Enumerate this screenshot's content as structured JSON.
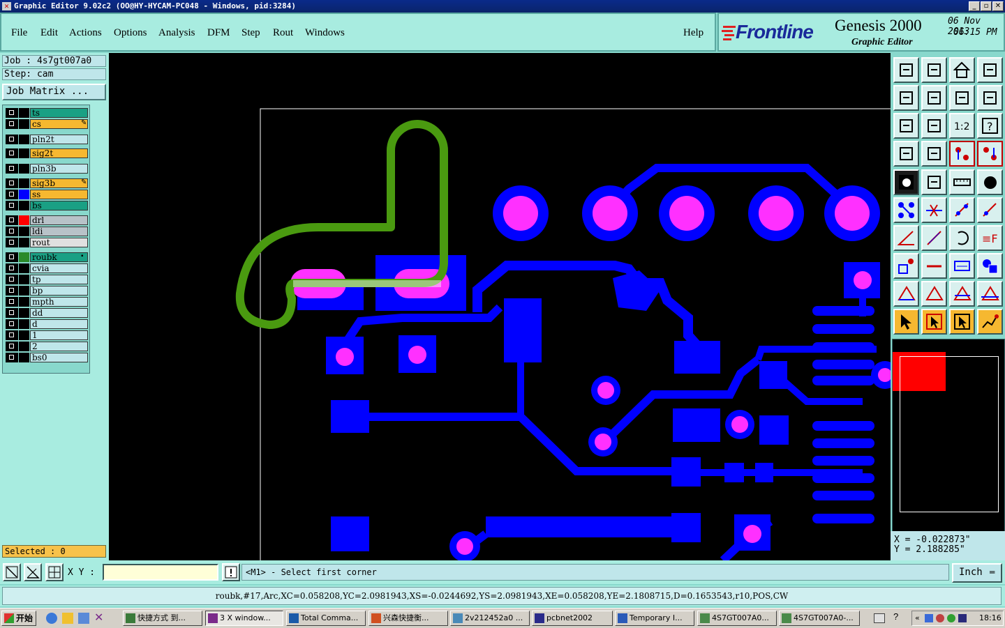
{
  "window": {
    "title": "Graphic Editor 9.02c2 (OO@HY-HYCAM-PC048 - Windows, pid:3284)"
  },
  "menu": [
    "File",
    "Edit",
    "Actions",
    "Options",
    "Analysis",
    "DFM",
    "Step",
    "Rout",
    "Windows"
  ],
  "help_label": "Help",
  "brand": {
    "logo": "Frontline",
    "product": "Genesis 2000",
    "subtitle": "Graphic Editor",
    "date": "06 Nov 2013",
    "time": "06:15 PM"
  },
  "job": {
    "job_line": "Job : 4s7gt007a0",
    "step_line": "Step: cam",
    "matrix_button": "Job Matrix ..."
  },
  "layers": [
    {
      "name": "ts",
      "color": "#1aa084",
      "swatch": "#000000",
      "mark": ""
    },
    {
      "name": "cs",
      "color": "#f6b830",
      "swatch": "#000000",
      "mark": "✎"
    },
    {
      "name": "pln2t",
      "color": "#bfe6ea",
      "swatch": "#000000",
      "mark": ""
    },
    {
      "name": "sig2t",
      "color": "#f6b830",
      "swatch": "#000000",
      "mark": ""
    },
    {
      "name": "pln3b",
      "color": "#bfe6ea",
      "swatch": "#000000",
      "mark": ""
    },
    {
      "name": "sig3b",
      "color": "#f6b830",
      "swatch": "#000000",
      "mark": "✎"
    },
    {
      "name": "ss",
      "color": "#f6b830",
      "swatch": "#0000ff",
      "mark": ""
    },
    {
      "name": "bs",
      "color": "#1aa084",
      "swatch": "#000000",
      "mark": ""
    },
    {
      "name": "drl",
      "color": "#b8c2c8",
      "swatch": "#ff0000",
      "mark": ""
    },
    {
      "name": "ldi",
      "color": "#b8c2c8",
      "swatch": "#000000",
      "mark": ""
    },
    {
      "name": "rout",
      "color": "#e0e0e0",
      "swatch": "#000000",
      "mark": ""
    },
    {
      "name": "roubk",
      "color": "#1aa084",
      "swatch": "#2a8a2a",
      "mark": "▪"
    },
    {
      "name": "cvia",
      "color": "#bfe6ea",
      "swatch": "#000000",
      "mark": ""
    },
    {
      "name": "tp",
      "color": "#bfe6ea",
      "swatch": "#000000",
      "mark": ""
    },
    {
      "name": "bp",
      "color": "#bfe6ea",
      "swatch": "#000000",
      "mark": ""
    },
    {
      "name": "mpth",
      "color": "#bfe6ea",
      "swatch": "#000000",
      "mark": ""
    },
    {
      "name": "dd",
      "color": "#bfe6ea",
      "swatch": "#000000",
      "mark": ""
    },
    {
      "name": "d",
      "color": "#bfe6ea",
      "swatch": "#000000",
      "mark": ""
    },
    {
      "name": "1",
      "color": "#bfe6ea",
      "swatch": "#000000",
      "mark": ""
    },
    {
      "name": "2",
      "color": "#bfe6ea",
      "swatch": "#000000",
      "mark": ""
    },
    {
      "name": "bs0",
      "color": "#bfe6ea",
      "swatch": "#000000",
      "mark": ""
    }
  ],
  "selected": "Selected : 0",
  "coordinates": {
    "x_line": "X = -0.022873\"",
    "y_line": "Y = 2.188285\""
  },
  "command": {
    "xy_label": "X Y :",
    "xy_value": "",
    "prompt": "<M1> - Select first corner",
    "units": "Inch"
  },
  "status": "roubk,#17,Arc,XC=0.058208,YC=2.0981943,XS=-0.0244692,YS=2.0981943,XE=0.058208,YE=2.1808715,D=0.1653543,r10,POS,CW",
  "taskbar": {
    "start": "开始",
    "items": [
      "快捷方式 到...",
      "3 X window...",
      "Total Comma...",
      "兴森快捷衡...",
      "2v212452a0 ...",
      "pcbnet2002",
      "Temporary I...",
      "4S7GT007A0...",
      "4S7GT007A0-..."
    ],
    "clock": "18:16"
  },
  "colors": {
    "copper": "#0000ff",
    "drill": "#ff30ff",
    "route": "#4a9a10",
    "canvas": "#000000",
    "panel": "#a8ece0"
  }
}
